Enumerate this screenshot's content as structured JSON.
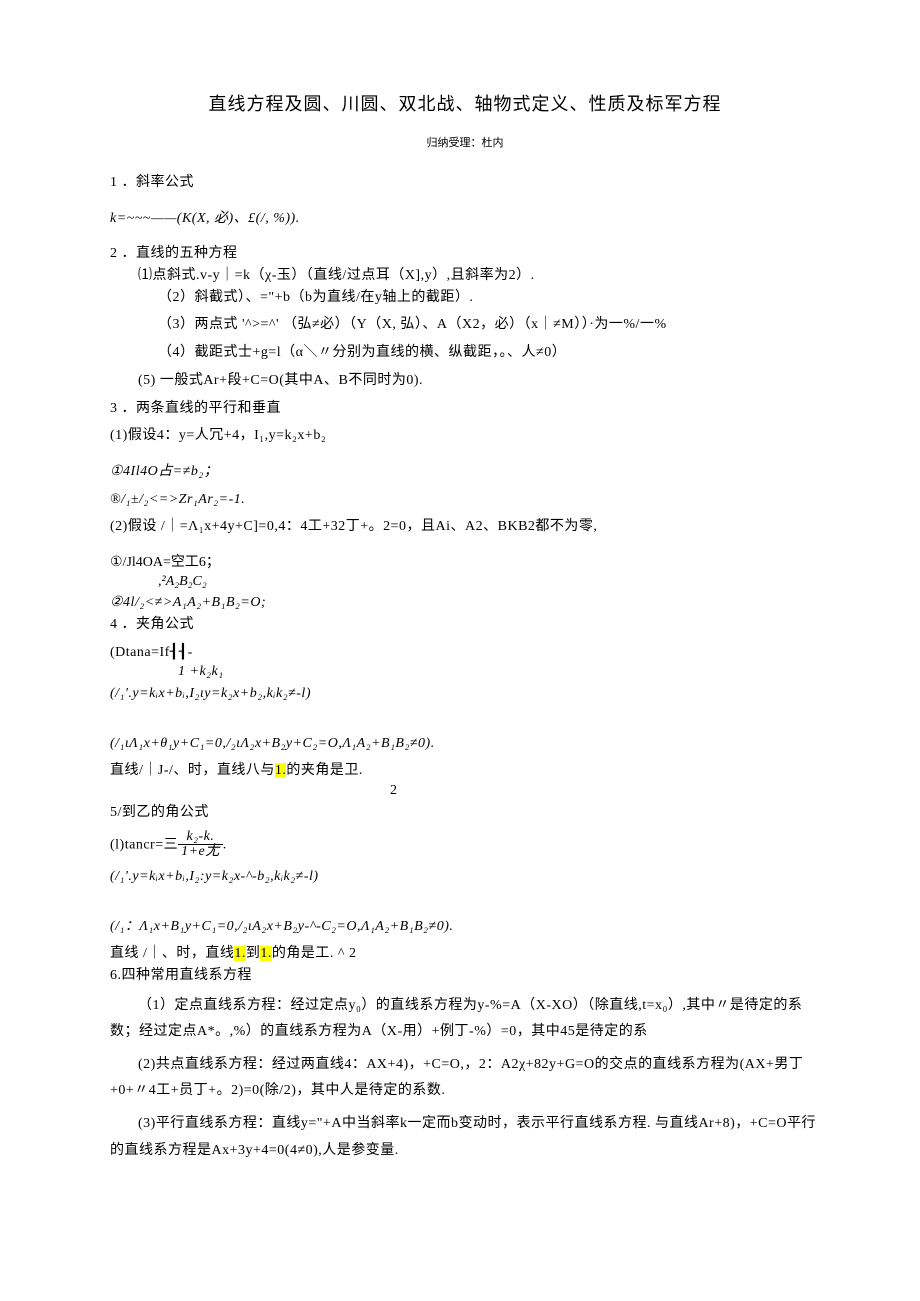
{
  "title": "直线方程及圆、川圆、双北战、轴物式定义、性质及标军方程",
  "author": "归纳受理：杜内",
  "s1_head": "1 ．斜率公式",
  "s1_body": "k=~~~——(K(X, 必)、£(/, %)).",
  "s2_head": "2 ．直线的五种方程",
  "s2_1": "⑴点斜式.v-y｜=k（χ-玉）（直线/过点耳（X],y）,且斜率为2）.",
  "s2_2": "（2）斜截式）、=\"+b（b为直线/在y轴上的截距）.",
  "s2_3": "（3）两点式 '^>=^' （弘≠必）（Y（X, 弘）、A（X2，必）（x｜≠M））·为一%/一%",
  "s2_4": "（4）截距式士+g=l（α＼〃分别为直线的横、纵截距，。、人≠0）",
  "s2_5": "(5)    一般式Ar+段+C=O(其中A、B不同时为0).",
  "s3_head": "3 ．两条直线的平行和垂直",
  "s3_1": "(1)假设4：y=人冗+4，I₁,y=k₂x+b₂",
  "s3_1a": "①4Il4O占=≠b₂；",
  "s3_1b": "®/₁±/₂<=>Zr₁Ar₂=-1.",
  "s3_2": "(2)假设 /｜=Λ₁x+4y+C]=0,4：4工+32丁+。2=0，且Ai、A2、BKB2都不为零,",
  "s3_2a_top": "①/Jl4OA=空工6；",
  "s3_2a_bot": ",²A₂B₂C₂",
  "s3_2b": "②4l/₂<≠>A₁A₂+B₁B₂=O;",
  "s4_head": "4 ．夹角公式",
  "s4_1_left": "(Dtana=If┨┨-",
  "s4_1_right": "1  +k₂k₁",
  "s4_2": "(/₁'.y=kᵢx+bᵢ,I₂ιy=k₂x+b₂,kᵢk₂≠-l)",
  "s4_3": "(/₁ιΛ₁x+θ₁y+C₁=0,/₂ιΛ₂x+B₂y+C₂=O,Λ₁A₂+B₁B₂≠0).",
  "s4_4a": "直线/｜J-/、时，直线八与",
  "s4_4hl": "1.",
  "s4_4b": "的夹角是卫.",
  "s4_4frac": "2",
  "s5_head": "5/到乙的角公式",
  "s5_1_left": "(l)tancr=三",
  "s5_1_num": "k₂-k.",
  "s5_1_den": "1+e尢",
  "s5_2": "(/₁'.y=kᵢx+bᵢ,I₂:y=k₂x-^-b₂,kᵢk₂≠-l)",
  "s5_3": "(/₁：Λ₁x+B₁y+C₁=0,/₂ιA₂x+B₂y-^-C₂=O,Λ₁A₂+B₁B₂≠0).",
  "s5_4a": "直线 /｜、时，直线",
  "s5_4hl1": "1.",
  "s5_4mid": "到",
  "s5_4hl2": "1.",
  "s5_4b": "的角是工. ^   2",
  "s6_head": "6.四种常用直线系方程",
  "s6_1": "（1）定点直线系方程：经过定点y₀）的直线系方程为y-%=A（X-XO）（除直线,t=x₀）,其中〃是待定的系数；经过定点A*。,%）的直线系方程为A（X-用）+例丁-%）=0，其中45是待定的系",
  "s6_2": "(2)共点直线系方程：经过两直线4：AX+4)，+C=O,，2：A2χ+82y+G=O的交点的直线系方程为(AX+男丁+0+〃4工+员丁+。2)=0(除/2)，其中人是待定的系数.",
  "s6_3": "(3)平行直线系方程：直线y=\"+A中当斜率k一定而b变动时，表示平行直线系方程. 与直线Ar+8)，+C=O平行的直线系方程是Ax+3y+4=0(4≠0),人是参变量."
}
